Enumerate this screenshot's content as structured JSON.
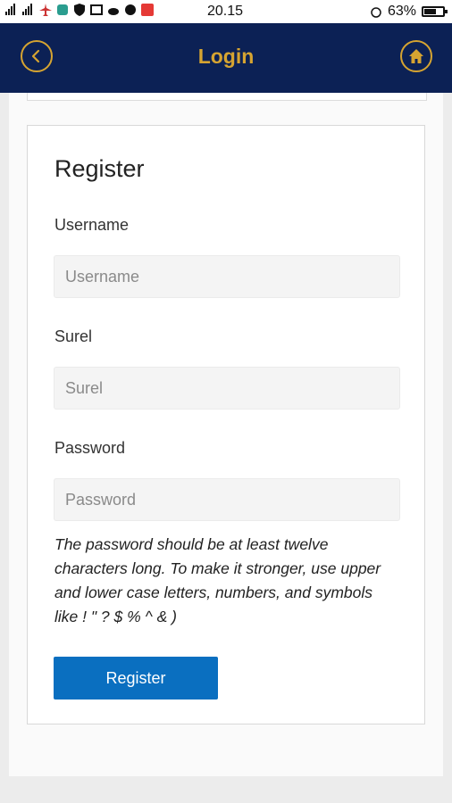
{
  "status_bar": {
    "time": "20.15",
    "battery": "63%",
    "battery_level": 0.63
  },
  "header": {
    "title": "Login",
    "back_icon": "chevron-left-icon",
    "home_icon": "home-icon",
    "accent_color": "#d6a431",
    "background_color": "#0c2155"
  },
  "register_form": {
    "title": "Register",
    "username": {
      "label": "Username",
      "placeholder": "Username",
      "value": ""
    },
    "email": {
      "label": "Surel",
      "placeholder": "Surel",
      "value": ""
    },
    "password": {
      "label": "Password",
      "placeholder": "Password",
      "value": ""
    },
    "password_hint": "The password should be at least twelve characters long. To make it stronger, use upper and lower case letters, numbers, and symbols like ! \" ? $ % ^ & )",
    "submit_label": "Register",
    "submit_color": "#0a6fc0"
  }
}
